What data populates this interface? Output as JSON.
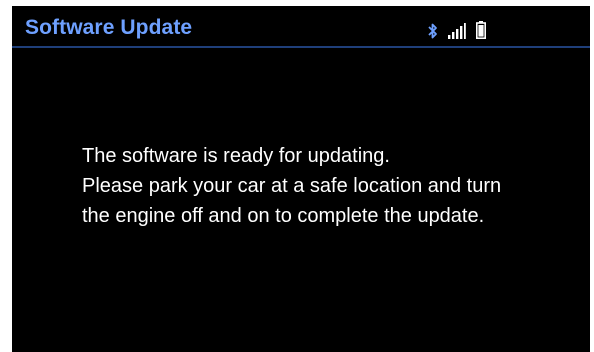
{
  "header": {
    "title": "Software Update",
    "status_icons": [
      "bluetooth-icon",
      "signal-strength-icon",
      "battery-icon"
    ]
  },
  "message": {
    "lines": [
      "The software is ready for updating.",
      "Please park your car at a safe location and turn",
      "the engine off and on to complete the update."
    ]
  },
  "colors": {
    "background": "#000000",
    "title": "#6ea0ff",
    "text": "#ffffff",
    "divider": "#1f3f7a"
  }
}
